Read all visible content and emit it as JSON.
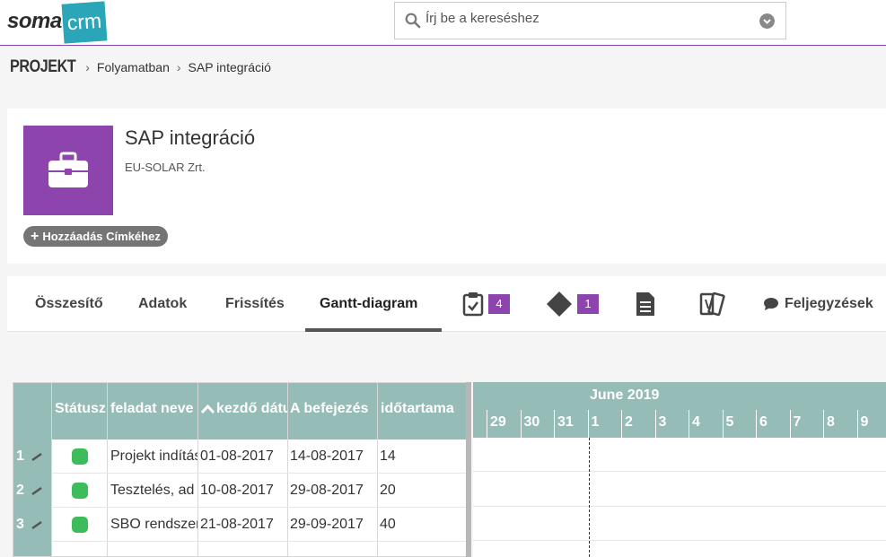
{
  "app": {
    "logo_left": "soma",
    "logo_right": "crm",
    "search": {
      "placeholder": "Írj be a kereséshez"
    }
  },
  "breadcrumb": {
    "root": "PROJEKT",
    "items": [
      "Folyamatban",
      "SAP integráció"
    ]
  },
  "project": {
    "title": "SAP integráció",
    "company": "EU-SOLAR Zrt.",
    "tag_button": "Hozzáadás Címkéhez",
    "icon": "briefcase-icon"
  },
  "tabs": {
    "summary": "Összesítő",
    "data": "Adatok",
    "updates": "Frissítés",
    "gantt": "Gantt-diagram",
    "tasks_badge": "4",
    "milestones_badge": "1",
    "notes": "Feljegyzések"
  },
  "grid": {
    "headers": [
      "Státusz",
      "feladat neve",
      "kezdő dátum",
      "A befejezés",
      "időtartama"
    ],
    "rows": [
      {
        "num": "1",
        "name": "Projekt indítás",
        "start": "01-08-2017",
        "end": "14-08-2017",
        "duration": "14",
        "status_color": "#3cbc5b"
      },
      {
        "num": "2",
        "name": "Tesztelés, ad",
        "start": "10-08-2017",
        "end": "29-08-2017",
        "duration": "20",
        "status_color": "#3cbc5b"
      },
      {
        "num": "3",
        "name": "SBO rendszer",
        "start": "21-08-2017",
        "end": "29-09-2017",
        "duration": "40",
        "status_color": "#3cbc5b"
      }
    ]
  },
  "gantt": {
    "month": "June 2019",
    "days": [
      "29",
      "30",
      "31",
      "1",
      "2",
      "3",
      "4",
      "5",
      "6",
      "7",
      "8",
      "9"
    ]
  },
  "colors": {
    "accent": "#8e44ad",
    "header_teal": "#96bcb8",
    "status_green": "#3cbc5b"
  }
}
